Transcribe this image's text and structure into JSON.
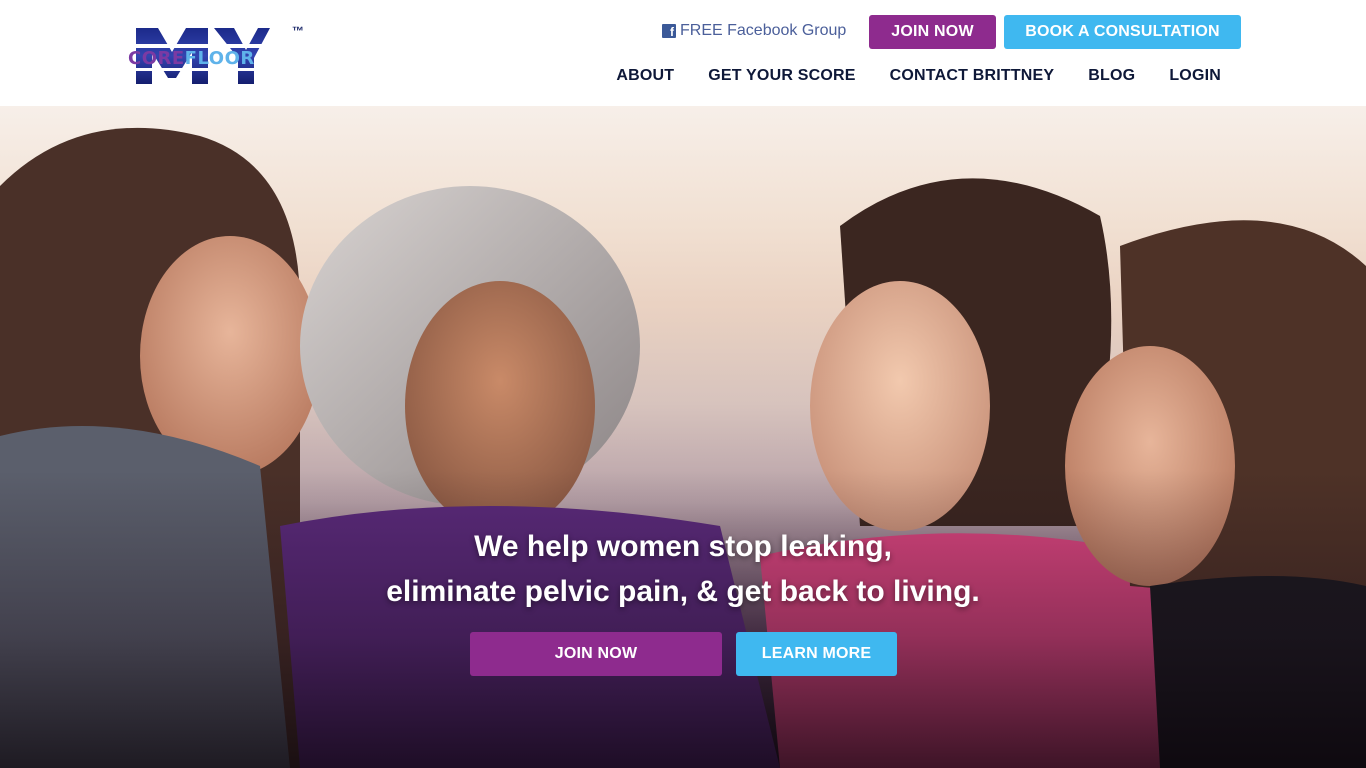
{
  "brand": {
    "logo_my": "MY",
    "logo_core": "CORE",
    "logo_floor": "FLOOR",
    "logo_tm": "™"
  },
  "header": {
    "facebook_icon": "facebook-icon",
    "facebook_label": "FREE Facebook Group",
    "join_label": "JOIN NOW",
    "consult_label": "BOOK A CONSULTATION"
  },
  "nav": {
    "items": [
      {
        "label": "ABOUT"
      },
      {
        "label": "GET YOUR SCORE"
      },
      {
        "label": "CONTACT BRITTNEY"
      },
      {
        "label": "BLOG"
      },
      {
        "label": "LOGIN"
      }
    ]
  },
  "hero": {
    "headline_line1": "We help women stop leaking,",
    "headline_line2": "eliminate pelvic pain, & get back to living.",
    "join_label": "JOIN NOW",
    "learn_label": "LEARN MORE"
  },
  "colors": {
    "purple": "#8e2b8e",
    "blue": "#3fb8f0",
    "nav_text": "#0e1838"
  }
}
